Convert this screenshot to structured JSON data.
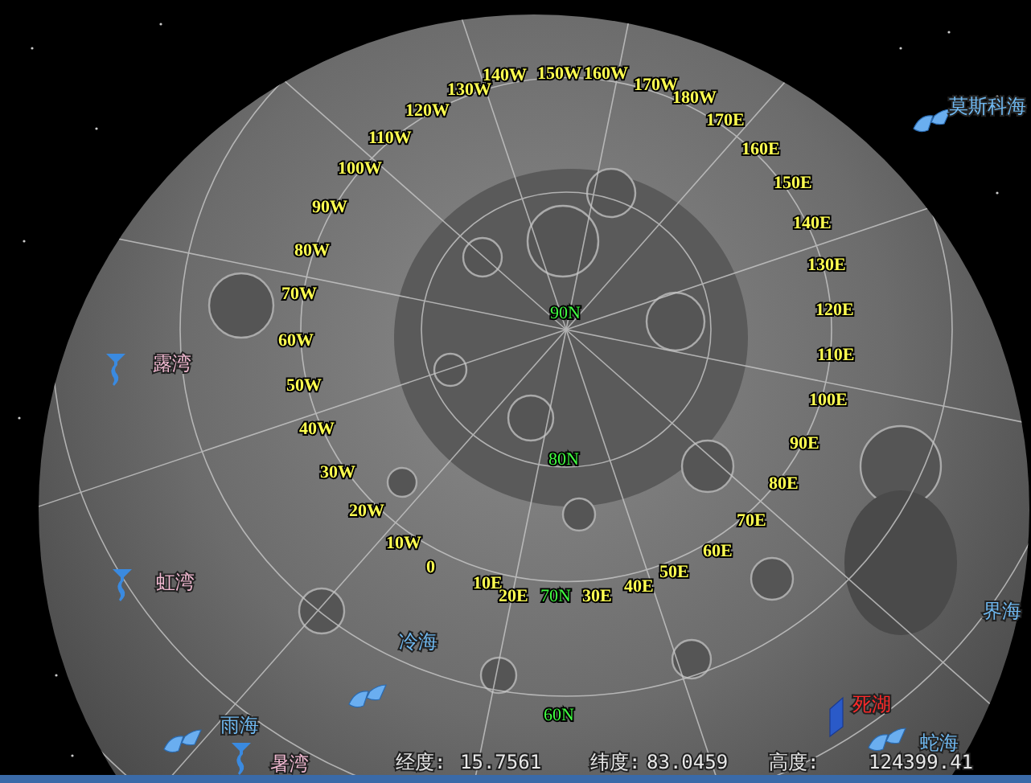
{
  "longitude_labels": [
    "140W",
    "150W",
    "160W",
    "170W",
    "130W",
    "180W",
    "120W",
    "170E",
    "110W",
    "160E",
    "100W",
    "150E",
    "90W",
    "140E",
    "80W",
    "130E",
    "70W",
    "120E",
    "60W",
    "110E",
    "50W",
    "100E",
    "40W",
    "90E",
    "30W",
    "80E",
    "20W",
    "70E",
    "10W",
    "60E",
    "0",
    "50E",
    "10E",
    "40E",
    "20E",
    "30E"
  ],
  "latitude_labels": [
    "90N",
    "80N",
    "70N",
    "60N"
  ],
  "places": [
    {
      "name": "莫斯科海",
      "kind": "sea",
      "marker": true
    },
    {
      "name": "露湾",
      "kind": "bay",
      "marker": true
    },
    {
      "name": "虹湾",
      "kind": "bay",
      "marker": true
    },
    {
      "name": "界海",
      "kind": "sea",
      "marker": false
    },
    {
      "name": "冷海",
      "kind": "sea",
      "marker": true
    },
    {
      "name": "雨海",
      "kind": "sea",
      "marker": true
    },
    {
      "name": "暑湾",
      "kind": "bay",
      "marker": true
    },
    {
      "name": "死湖",
      "kind": "lake",
      "marker": true
    },
    {
      "name": "蛇海",
      "kind": "sea",
      "marker": true
    }
  ],
  "status_bar": [
    {
      "label": "经度:",
      "value": "15.7561"
    },
    {
      "label": "纬度:",
      "value": "83.0459"
    },
    {
      "label": "高度:",
      "value": "124399.41"
    }
  ]
}
